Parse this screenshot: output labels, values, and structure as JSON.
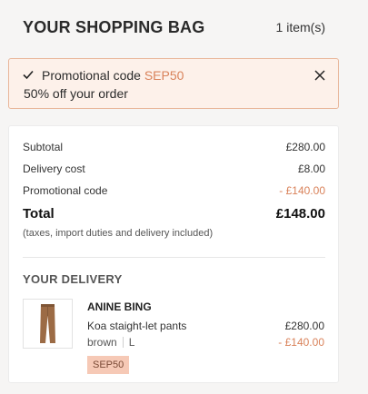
{
  "header": {
    "title": "YOUR SHOPPING BAG",
    "item_count": "1 item(s)"
  },
  "promo_banner": {
    "prefix": "Promotional code ",
    "code": "SEP50",
    "description": "50% off your order",
    "icons": {
      "check": "check-icon",
      "close": "close-icon"
    }
  },
  "summary": {
    "rows": [
      {
        "label": "Subtotal",
        "value": "£280.00"
      },
      {
        "label": "Delivery cost",
        "value": "£8.00"
      },
      {
        "label": "Promotional code",
        "value": "- £140.00"
      }
    ],
    "total_label": "Total",
    "total_value": "£148.00",
    "note": "(taxes, import duties and delivery included)"
  },
  "delivery": {
    "title": "YOUR DELIVERY",
    "item": {
      "brand": "ANINE BING",
      "name": "Koa staight-let pants",
      "color": "brown",
      "size": "L",
      "price": "£280.00",
      "discount": "- £140.00",
      "promo_tag": "SEP50"
    }
  },
  "colors": {
    "accent": "#d9825a",
    "promo_bg": "#fdf1ea",
    "tag_bg": "#f6c9b6"
  }
}
